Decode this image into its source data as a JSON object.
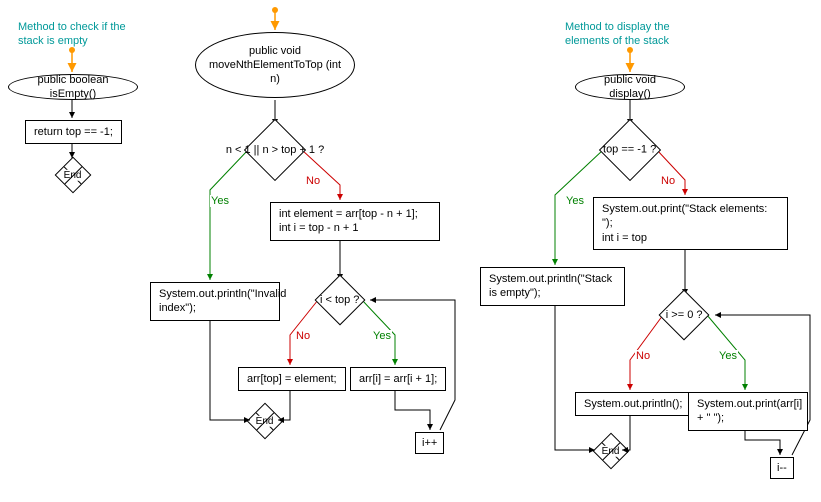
{
  "flowchart1": {
    "caption": "Method to check if the stack is empty",
    "start": "public boolean isEmpty()",
    "stmt1": "return top == -1;",
    "end": "End"
  },
  "flowchart2": {
    "start": "public void moveNthElementToTop (int n)",
    "cond1": "n < 1 || n > top + 1 ?",
    "stmt_invalid": "System.out.println(\"Invalid index\");",
    "stmt_assign": "int element = arr[top - n + 1];\nint i = top - n + 1",
    "cond2": "i < top ?",
    "stmt_top": "arr[top] = element;",
    "stmt_shift": "arr[i] = arr[i + 1];",
    "inc": "i++",
    "end": "End",
    "yes": "Yes",
    "no": "No"
  },
  "flowchart3": {
    "caption": "Method to display the elements of the stack",
    "start": "public void display()",
    "cond1": "top == -1 ?",
    "stmt_empty": "System.out.println(\"Stack is empty\");",
    "stmt_header": "System.out.print(\"Stack elements: \");\nint i = top",
    "cond2": "i >= 0 ?",
    "stmt_println": "System.out.println();",
    "stmt_print": "System.out.print(arr[i] + \" \");",
    "dec": "i--",
    "end": "End",
    "yes": "Yes",
    "no": "No"
  }
}
